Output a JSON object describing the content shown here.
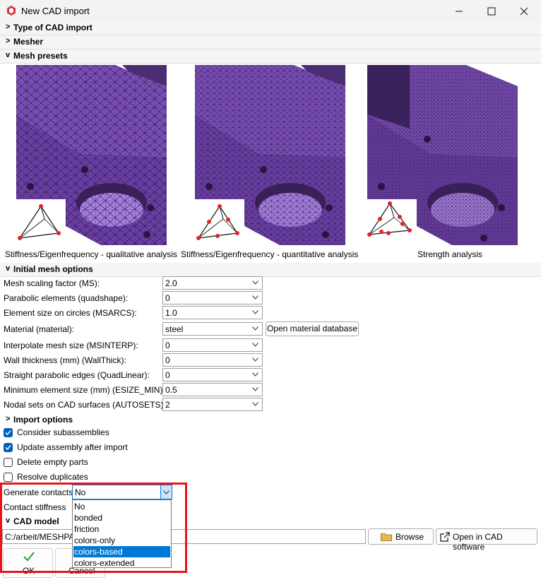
{
  "window": {
    "title": "New CAD import"
  },
  "sections": {
    "type": {
      "chevron": ">",
      "label": "Type of CAD import"
    },
    "mesher": {
      "chevron": ">",
      "label": "Mesher"
    },
    "presets": {
      "chevron": "v",
      "label": "Mesh presets"
    },
    "initial": {
      "chevron": "v",
      "label": "Initial mesh options"
    },
    "import": {
      "chevron": ">",
      "label": "Import options"
    },
    "cad_model": {
      "chevron": "v",
      "label": "CAD model"
    }
  },
  "presets": [
    {
      "caption": "Stiffness/Eigenfrequency - qualitative analysis"
    },
    {
      "caption": "Stiffness/Eigenfrequency - quantitative analysis"
    },
    {
      "caption": "Strength analysis"
    }
  ],
  "mesh_options": [
    {
      "label": "Mesh scaling factor (MS):",
      "value": "2.0"
    },
    {
      "label": "Parabolic elements (quadshape):",
      "value": "0"
    },
    {
      "label": "Element size on circles (MSARCS):",
      "value": "1.0"
    },
    {
      "label": "Material (material):",
      "value": "steel"
    },
    {
      "label": "Interpolate mesh size (MSINTERP):",
      "value": "0"
    },
    {
      "label": "Wall thickness (mm) (WallThick):",
      "value": "0"
    },
    {
      "label": "Straight parabolic edges (QuadLinear):",
      "value": "0"
    },
    {
      "label": "Minimum element size (mm) (ESIZE_MIN):",
      "value": "0.5"
    },
    {
      "label": "Nodal sets on CAD surfaces (AUTOSETS):",
      "value": "2"
    }
  ],
  "open_material_db_label": "Open material database",
  "checkboxes": [
    {
      "label": "Consider subassemblies",
      "checked": true
    },
    {
      "label": "Update assembly after import",
      "checked": true
    },
    {
      "label": "Delete empty parts",
      "checked": false
    },
    {
      "label": "Resolve duplicates",
      "checked": false
    }
  ],
  "generate_contacts": {
    "label": "Generate contacts",
    "value": "No",
    "options": [
      "No",
      "bonded",
      "friction",
      "colors-only",
      "colors-based",
      "colors-extended"
    ],
    "highlighted": "colors-based"
  },
  "contact_stiffness": {
    "label": "Contact stiffness"
  },
  "cad_model": {
    "path": "C:/arbeit/MESHPA",
    "browse_label": "Browse",
    "open_cad_label": "Open in CAD software"
  },
  "footer": {
    "ok_label": "OK",
    "cancel_label": "Cancel"
  },
  "colors": {
    "accent": "#005fb8",
    "highlight": "#0078d7",
    "annotation": "#e4151d",
    "mesh": "#7b4fb8"
  }
}
